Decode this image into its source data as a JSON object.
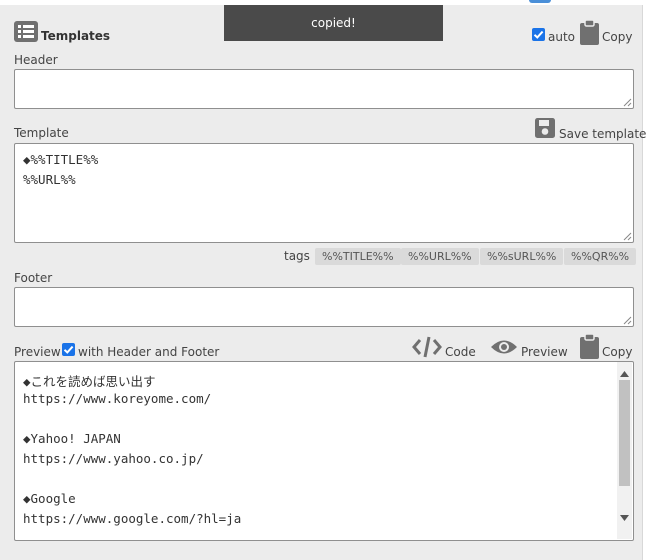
{
  "toast": {
    "text": "copied!"
  },
  "header_bar": {
    "title": "Templates",
    "auto_label": "auto",
    "auto_checked": true,
    "copy_label": "Copy"
  },
  "header_field": {
    "label": "Header",
    "value": ""
  },
  "template_field": {
    "label": "Template",
    "save_label": "Save template",
    "lines": [
      "◆%%TITLE%%",
      "%%URL%%"
    ]
  },
  "tags": {
    "label": "tags",
    "items": [
      "%%TITLE%%",
      "%%URL%%",
      "%%sURL%%",
      "%%QR%%"
    ]
  },
  "footer_field": {
    "label": "Footer",
    "value": ""
  },
  "preview": {
    "label": "Preview",
    "with_hf_label": "with Header and Footer",
    "with_hf_checked": true,
    "code_label": "Code",
    "preview_label": "Preview",
    "copy_label": "Copy",
    "lines": [
      "◆これを読めば思い出す",
      "https://www.koreyome.com/",
      "",
      "◆Yahoo! JAPAN",
      "https://www.yahoo.co.jp/",
      "",
      "◆Google",
      "https://www.google.com/?hl=ja"
    ]
  },
  "colors": {
    "accent": "#1a73e8",
    "icon_gray": "#707070",
    "toast_bg": "#4a4a4a"
  }
}
